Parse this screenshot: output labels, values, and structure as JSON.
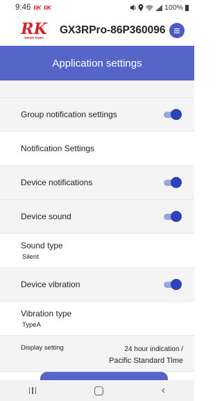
{
  "status": {
    "time": "9:46",
    "battery": "100%",
    "app_marks": [
      "RK",
      "RK"
    ]
  },
  "header": {
    "logo_text": "RK",
    "logo_sub": "RIKEN KEIKI",
    "device_name": "GX3RPro-86P360096",
    "menu_icon": "menu-icon"
  },
  "title": "Application settings",
  "settings": {
    "group_notification": {
      "label": "Group notification settings",
      "enabled": true
    },
    "notification_header": "Notification Settings",
    "device_notifications": {
      "label": "Device notifications",
      "enabled": true
    },
    "device_sound": {
      "label": "Device sound",
      "enabled": true
    },
    "sound_type": {
      "label": "Sound type",
      "value": "Silent"
    },
    "device_vibration": {
      "label": "Device vibration",
      "enabled": true
    },
    "vibration_type": {
      "label": "Vibration type",
      "value": "TypeA"
    },
    "display_setting": {
      "label": "Display setting",
      "value_line1": "24 hour indication /",
      "value_line2": "Pacific Standard Time"
    }
  },
  "colors": {
    "accent": "#5566c8",
    "toggle_on": "#2f43b8",
    "brand_red": "#d2232a"
  }
}
